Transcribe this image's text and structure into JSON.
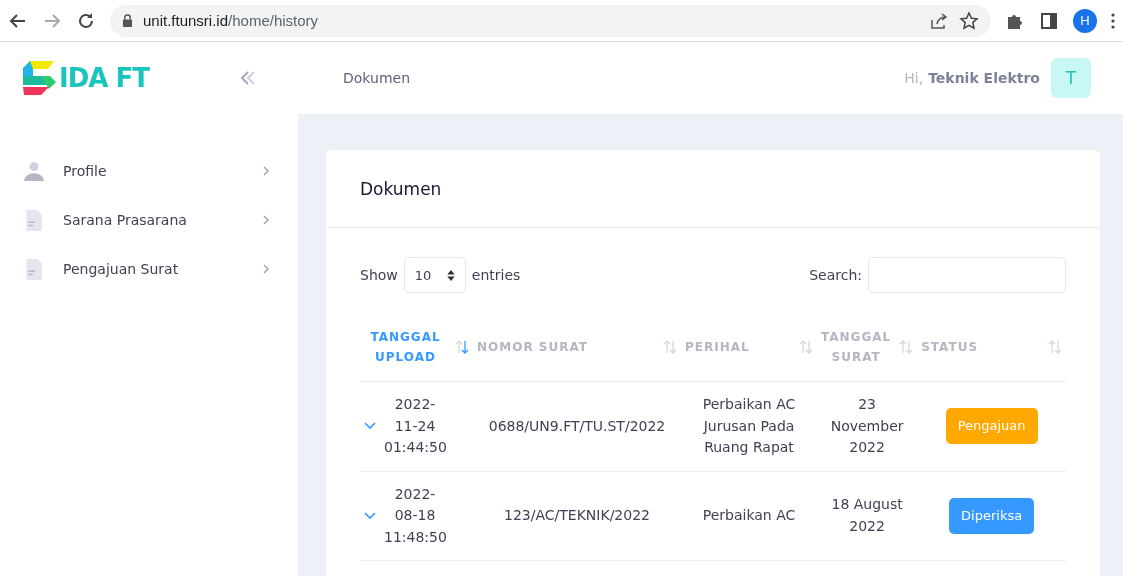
{
  "browser": {
    "url_host": "unit.ftunsri.id",
    "url_path": "/home/history",
    "profile_initial": "H"
  },
  "sidebar": {
    "logo_text": "IDA FT",
    "items": [
      {
        "label": "Profile",
        "kind": "person"
      },
      {
        "label": "Sarana Prasarana",
        "kind": "document"
      },
      {
        "label": "Pengajuan Surat",
        "kind": "document"
      }
    ]
  },
  "header": {
    "breadcrumb": "Dokumen",
    "greeting": "Hi,",
    "user_name": "Teknik Elektro",
    "avatar_initial": "T"
  },
  "card": {
    "title": "Dokumen",
    "show_label": "Show",
    "page_size": "10",
    "entries_label": "entries",
    "search_label": "Search:",
    "table": {
      "columns": [
        {
          "label": "TANGGAL UPLOAD",
          "sorted": true
        },
        {
          "label": "NOMOR SURAT",
          "sorted": false
        },
        {
          "label": "PERIHAL",
          "sorted": false
        },
        {
          "label": "TANGGAL SURAT",
          "sorted": false
        },
        {
          "label": "STATUS",
          "sorted": false
        }
      ],
      "rows": [
        {
          "tanggal_upload": "2022-11-24 01:44:50",
          "nomor_surat": "0688/UN9.FT/TU.ST/2022",
          "perihal": "Perbaikan AC Jurusan Pada Ruang Rapat",
          "tanggal_surat": "23 November 2022",
          "status": "Pengajuan",
          "color": "#ffa800"
        },
        {
          "tanggal_upload": "2022-08-18 11:48:50",
          "nomor_surat": "123/AC/TEKNIK/2022",
          "perihal": "Perbaikan AC",
          "tanggal_surat": "18 August 2022",
          "status": "Diperiksa",
          "color": "#3699ff"
        }
      ]
    }
  }
}
